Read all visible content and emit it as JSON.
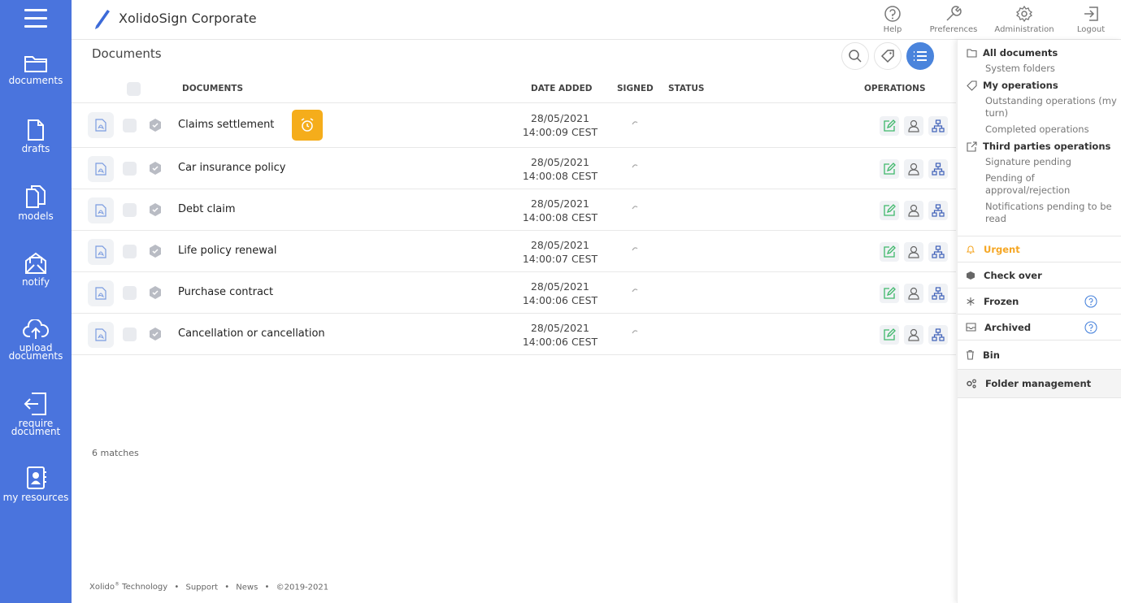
{
  "sidebar": {
    "items": [
      {
        "label": "documents",
        "icon": "folder-icon"
      },
      {
        "label": "drafts",
        "icon": "draft-file-icon"
      },
      {
        "label": "models",
        "icon": "models-files-icon"
      },
      {
        "label": "notify",
        "icon": "notify-envelope-icon"
      },
      {
        "label": "upload documents",
        "icon": "cloud-upload-icon"
      },
      {
        "label": "require document",
        "icon": "require-document-icon"
      },
      {
        "label": "my resources",
        "icon": "contacts-book-icon"
      }
    ]
  },
  "header": {
    "title": "XolidoSign Corporate",
    "help": "Help",
    "preferences": "Preferences",
    "administration": "Administration",
    "logout": "Logout"
  },
  "main": {
    "title": "Documents",
    "columns": {
      "documents": "DOCUMENTS",
      "date_added": "DATE ADDED",
      "signed": "SIGNED",
      "status": "STATUS",
      "operations": "OPERATIONS"
    },
    "rows": [
      {
        "name": "Claims settlement",
        "date": "28/05/2021",
        "time": "14:00:09 CEST",
        "alert": true
      },
      {
        "name": "Car insurance policy",
        "date": "28/05/2021",
        "time": "14:00:08 CEST",
        "alert": false
      },
      {
        "name": "Debt claim",
        "date": "28/05/2021",
        "time": "14:00:08 CEST",
        "alert": false
      },
      {
        "name": "Life policy renewal",
        "date": "28/05/2021",
        "time": "14:00:07 CEST",
        "alert": false
      },
      {
        "name": "Purchase contract",
        "date": "28/05/2021",
        "time": "14:00:06 CEST",
        "alert": false
      },
      {
        "name": "Cancellation or cancellation",
        "date": "28/05/2021",
        "time": "14:00:06 CEST",
        "alert": false
      }
    ],
    "matches": "6 matches"
  },
  "footer": {
    "brand": "Xolido",
    "reg": "®",
    "brand_rest": " Technology",
    "sep": "•",
    "support": "Support",
    "news": "News",
    "copyright": "©2019-2021"
  },
  "right_panel": {
    "all_documents": "All documents",
    "system_folders": "System folders",
    "my_operations": "My operations",
    "outstanding": "Outstanding operations (my turn)",
    "completed": "Completed operations",
    "third_parties": "Third parties operations",
    "signature_pending": "Signature pending",
    "pending_approval": "Pending of approval/rejection",
    "notifications_pending": "Notifications pending to be read",
    "urgent": "Urgent",
    "check_over": "Check over",
    "frozen": "Frozen",
    "archived": "Archived",
    "bin": "Bin",
    "folder_management": "Folder management"
  },
  "colors": {
    "sidebar": "#4a74dd",
    "accent": "#4a84dc",
    "urgent": "#f5a623",
    "edit_green": "#3fb86b",
    "alert_badge": "#f5ad1b"
  }
}
